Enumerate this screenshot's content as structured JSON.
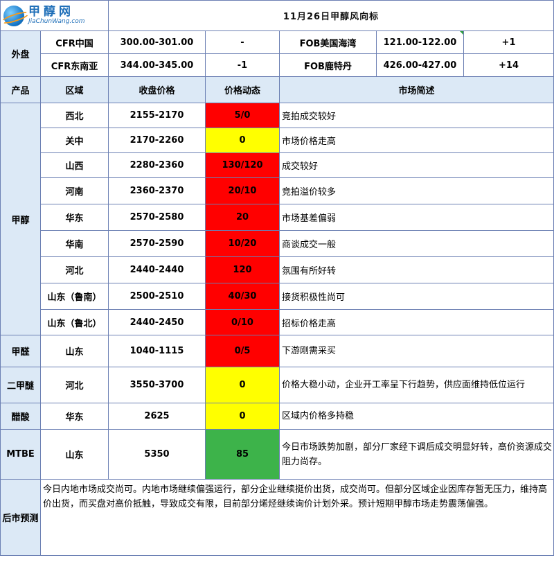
{
  "logo": {
    "cn": "甲醇网",
    "en": "JiaChunWang.com"
  },
  "title": "11月26日甲醇风向标",
  "external": {
    "label": "外盘",
    "rows": [
      {
        "left_name": "CFR中国",
        "left_price": "300.00-301.00",
        "left_change": "-",
        "right_name": "FOB美国海湾",
        "right_price": "121.00-122.00",
        "right_change": "+1"
      },
      {
        "left_name": "CFR东南亚",
        "left_price": "344.00-345.00",
        "left_change": "-1",
        "right_name": "FOB鹿特丹",
        "right_price": "426.00-427.00",
        "right_change": "+14"
      }
    ]
  },
  "headers": {
    "product": "产品",
    "region": "区域",
    "close_price": "收盘价格",
    "price_move": "价格动态",
    "market_desc": "市场简述"
  },
  "methanol": {
    "product": "甲醇",
    "rows": [
      {
        "region": "西北",
        "price": "2155-2170",
        "move": "5/0",
        "color": "#ff0000",
        "desc": "竞拍成交较好"
      },
      {
        "region": "关中",
        "price": "2170-2260",
        "move": "0",
        "color": "#ffff00",
        "desc": "市场价格走高"
      },
      {
        "region": "山西",
        "price": "2280-2360",
        "move": "130/120",
        "color": "#ff0000",
        "desc": "成交较好"
      },
      {
        "region": "河南",
        "price": "2360-2370",
        "move": "20/10",
        "color": "#ff0000",
        "desc": "竞拍溢价较多"
      },
      {
        "region": "华东",
        "price": "2570-2580",
        "move": "20",
        "color": "#ff0000",
        "desc": "市场基差偏弱"
      },
      {
        "region": "华南",
        "price": "2570-2590",
        "move": "10/20",
        "color": "#ff0000",
        "desc": "商谈成交一般"
      },
      {
        "region": "河北",
        "price": "2440-2440",
        "move": "120",
        "color": "#ff0000",
        "desc": "氛围有所好转"
      },
      {
        "region": "山东（鲁南）",
        "price": "2500-2510",
        "move": "40/30",
        "color": "#ff0000",
        "desc": "接货积极性尚可"
      },
      {
        "region": "山东（鲁北）",
        "price": "2440-2450",
        "move": "0/10",
        "color": "#ff0000",
        "desc": "招标价格走高"
      }
    ]
  },
  "others": [
    {
      "product": "甲醛",
      "region": "山东",
      "price": "1040-1115",
      "move": "0/5",
      "color": "#ff0000",
      "desc": "下游刚需采买"
    },
    {
      "product": "二甲醚",
      "region": "河北",
      "price": "3550-3700",
      "move": "0",
      "color": "#ffff00",
      "desc": "价格大稳小动，企业开工率呈下行趋势，供应面维持低位运行"
    },
    {
      "product": "醋酸",
      "region": "华东",
      "price": "2625",
      "move": "0",
      "color": "#ffff00",
      "desc": "区域内价格多持稳"
    },
    {
      "product": "MTBE",
      "region": "山东",
      "price": "5350",
      "move": "85",
      "color": "#3db34a",
      "desc": "今日市场跌势加剧，部分厂家经下调后成交明显好转，高价资源成交阻力尚存。"
    }
  ],
  "forecast": {
    "label": "后市预测",
    "text": "今日内地市场成交尚可。内地市场继续偏强运行，部分企业继续挺价出货，成交尚可。但部分区域企业因库存暂无压力，维持高价出货，而买盘对高价抵触，导致成交有限，目前部分烯烃继续询价计划外采。预计短期甲醇市场走势震荡偏强。"
  }
}
